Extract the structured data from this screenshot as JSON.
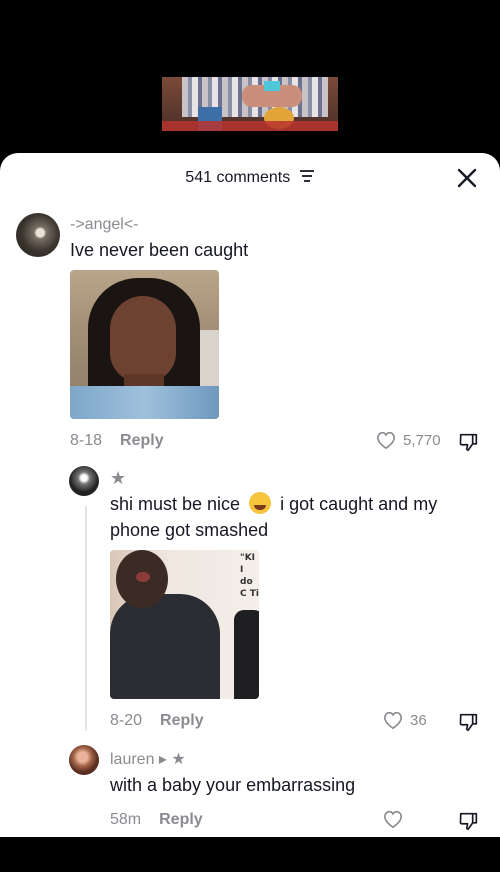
{
  "header": {
    "count_label": "541 comments"
  },
  "comments": [
    {
      "username": "->angel<-",
      "text": "Ive never been caught",
      "date": "8-18",
      "reply_label": "Reply",
      "likes": "5,770"
    },
    {
      "username": "★",
      "text_before_emoji": "shi must be nice",
      "text_after_emoji": "i got caught and my phone got smashed",
      "date": "8-20",
      "reply_label": "Reply",
      "likes": "36",
      "image_caption_lines": [
        "\"KI",
        "I do",
        "C Ti"
      ]
    },
    {
      "username": "lauren ▸ ★",
      "text": "with a baby your embarrassing",
      "date": "58m",
      "reply_label": "Reply",
      "likes": ""
    }
  ],
  "icons": [
    "filter-icon",
    "close-icon",
    "heart-icon",
    "dislike-icon"
  ],
  "colors": {
    "sheet_bg": "#ffffff",
    "muted_text": "#8a8b91",
    "primary_text": "#161823"
  }
}
